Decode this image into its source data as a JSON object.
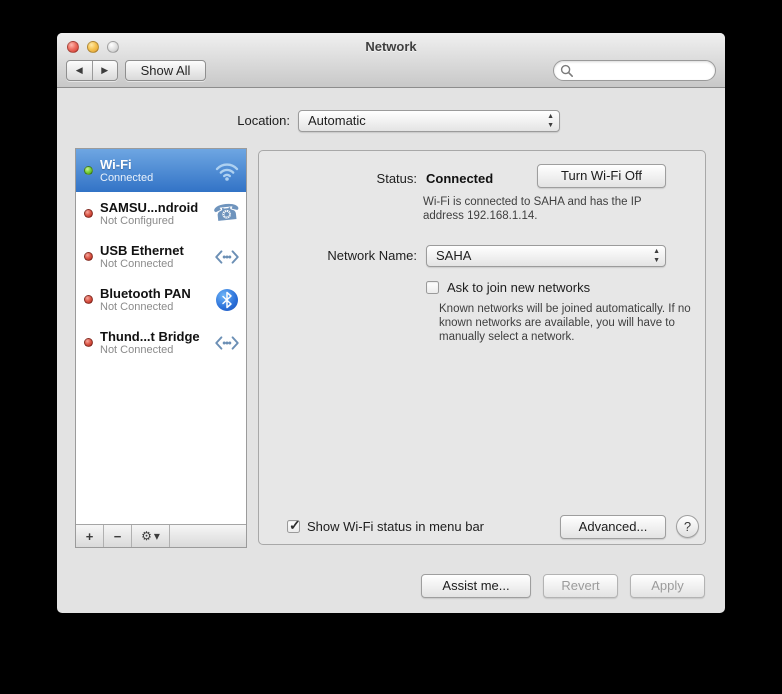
{
  "window": {
    "title": "Network"
  },
  "toolbar": {
    "show_all_label": "Show All",
    "search_placeholder": ""
  },
  "location": {
    "label": "Location:",
    "value": "Automatic"
  },
  "sidebar": {
    "items": [
      {
        "name": "Wi-Fi",
        "status": "Connected",
        "dot": "green",
        "icon": "wifi",
        "selected": true
      },
      {
        "name": "SAMSU...ndroid",
        "status": "Not Configured",
        "dot": "red",
        "icon": "phone",
        "selected": false
      },
      {
        "name": "USB Ethernet",
        "status": "Not Connected",
        "dot": "red",
        "icon": "ethernet",
        "selected": false
      },
      {
        "name": "Bluetooth PAN",
        "status": "Not Connected",
        "dot": "red",
        "icon": "bluetooth",
        "selected": false
      },
      {
        "name": "Thund...t Bridge",
        "status": "Not Connected",
        "dot": "red",
        "icon": "ethernet",
        "selected": false
      }
    ]
  },
  "main": {
    "status_label": "Status:",
    "status_value": "Connected",
    "turn_off_button": "Turn Wi-Fi Off",
    "status_description": "Wi-Fi is connected to SAHA and has the IP address 192.168.1.14.",
    "network_name_label": "Network Name:",
    "network_name_value": "SAHA",
    "ask_join_label": "Ask to join new networks",
    "ask_join_checked": false,
    "ask_join_description": "Known networks will be joined automatically. If no known networks are available, you will have to manually select a network.",
    "show_status_label": "Show Wi-Fi status in menu bar",
    "show_status_checked": true,
    "advanced_button": "Advanced...",
    "help_button": "?"
  },
  "footer_buttons": {
    "assist": "Assist me...",
    "revert": "Revert",
    "apply": "Apply"
  },
  "icons": {
    "back": "◀",
    "forward": "▶",
    "arrow_up": "▲",
    "arrow_down": "▼",
    "add": "+",
    "remove": "−",
    "gear": "⚙",
    "gear_caret": "▾",
    "check": "✓",
    "phone": "☎"
  },
  "colors": {
    "selection_top": "#6ea6e2",
    "selection_bottom": "#3273c6",
    "status_green": "#7ed43c",
    "status_red": "#dd5b4b",
    "bluetooth_blue": "#2a6fd8",
    "window_bg": "#e3e3e3",
    "desktop_bg": "#000000"
  }
}
